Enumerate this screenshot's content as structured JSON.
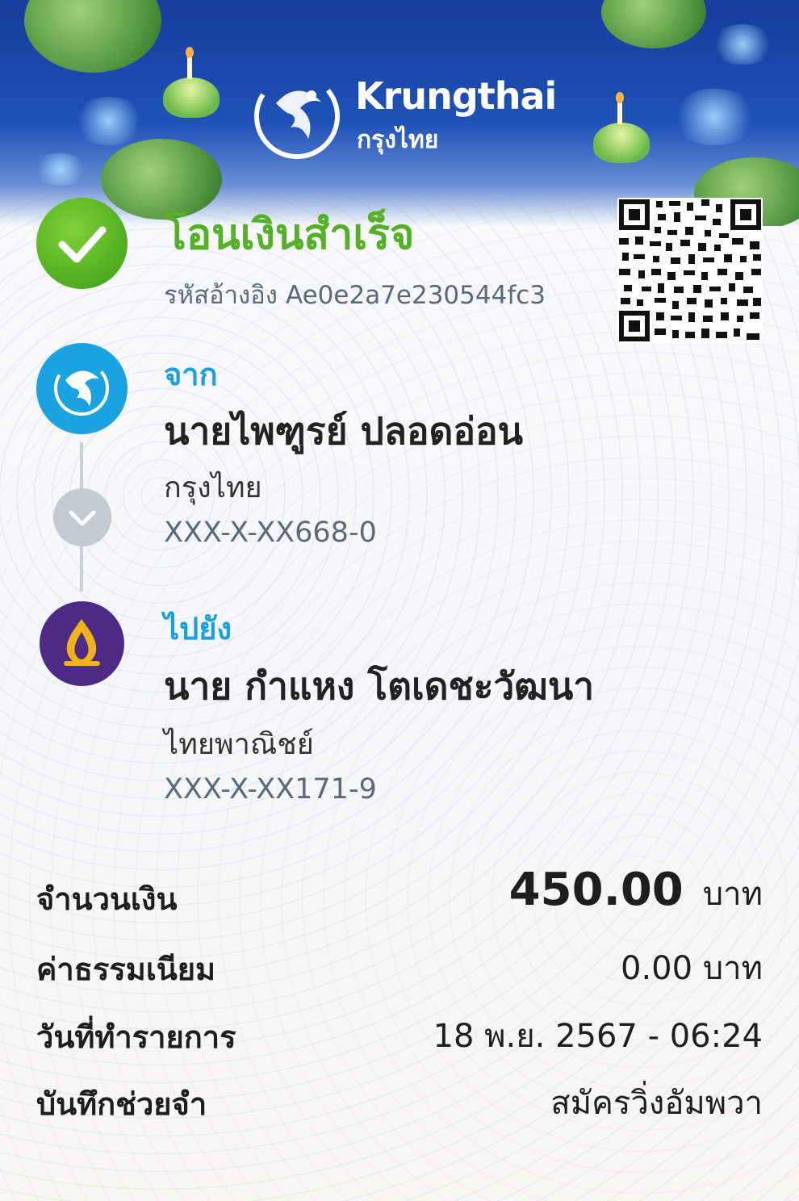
{
  "brand": {
    "name_en": "Krungthai",
    "name_th": "กรุงไทย"
  },
  "status": {
    "title": "โอนเงินสำเร็จ",
    "ref_label": "รหัสอ้างอิง",
    "ref_code": "Ae0e2a7e230544fc3",
    "color": "#55b027"
  },
  "from": {
    "label": "จาก",
    "name": "นายไพฑูรย์ ปลอดอ่อน",
    "bank": "กรุงไทย",
    "account": "XXX-X-XX668-0"
  },
  "to": {
    "label": "ไปยัง",
    "name": "นาย กำแหง โตเดชะวัฒนา",
    "bank": "ไทยพาณิชย์",
    "account": "XXX-X-XX171-9"
  },
  "details": {
    "amount_label": "จำนวนเงิน",
    "amount_value": "450.00",
    "amount_unit": "บาท",
    "fee_label": "ค่าธรรมเนียม",
    "fee_value": "0.00 บาท",
    "date_label": "วันที่ทำรายการ",
    "date_value": "18 พ.ย. 2567 - 06:24",
    "memo_label": "บันทึกช่วยจำ",
    "memo_value": "สมัครวิ่งอัมพวา"
  },
  "icons": {
    "status": "check-icon",
    "from_bank": "krungthai-logo-icon",
    "to_bank": "scb-logo-icon",
    "direction": "chevron-down-icon",
    "qr": "qr-code-icon"
  },
  "colors": {
    "accent_blue": "#19a1dd",
    "krungthai_blue": "#1aa3e0",
    "scb_purple": "#4d2a86",
    "scb_gold": "#f2b21a"
  }
}
